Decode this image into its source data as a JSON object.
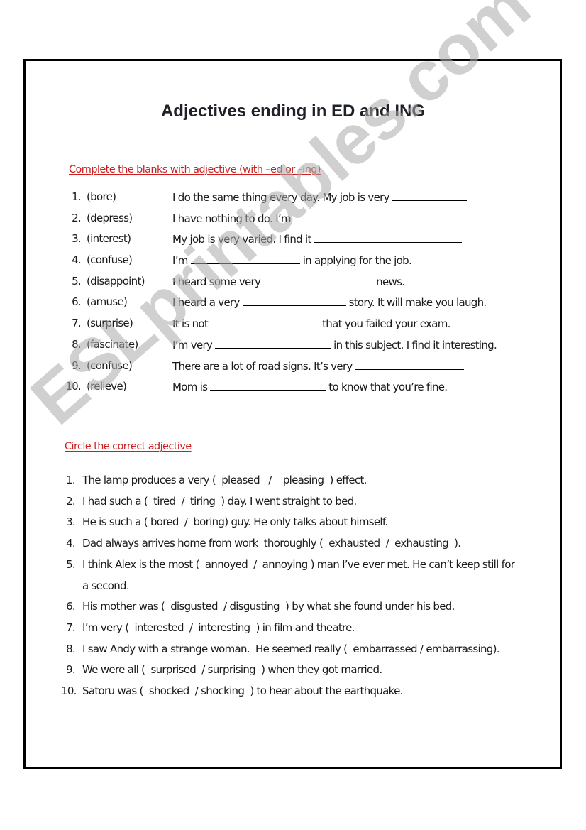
{
  "document": {
    "title": "Adjectives ending in ED and ING",
    "watermark": "ESLprintables.com",
    "colors": {
      "heading_red": "#cc1f1f",
      "text": "#1a1a1a",
      "border": "#000000",
      "watermark": "#c8c8c8"
    }
  },
  "exercise1": {
    "heading": "Complete the blanks with  adjective (with –ed or –ing)",
    "items": [
      {
        "num": "1.",
        "verb": "(bore)",
        "before": "I do the same thing every day. My job is very",
        "after": ""
      },
      {
        "num": "2.",
        "verb": "(depress)",
        "before": "I have nothing to do. I’m",
        "after": ""
      },
      {
        "num": "3.",
        "verb": "(interest)",
        "before": "My job is very varied. I find it",
        "after": ""
      },
      {
        "num": "4.",
        "verb": "(confuse)",
        "before": "I’m",
        "after": "in applying for the job."
      },
      {
        "num": "5.",
        "verb": "(disappoint)",
        "before": "I heard some very",
        "after": "news."
      },
      {
        "num": "6.",
        "verb": "(amuse)",
        "before": "I heard a very",
        "after": "story. It will make you laugh."
      },
      {
        "num": "7.",
        "verb": "(surprise)",
        "before": "It is not",
        "after": "that you failed your exam."
      },
      {
        "num": "8.",
        "verb": "(fascinate)",
        "before": "I’m very",
        "after": "in this subject. I find it interesting."
      },
      {
        "num": "9.",
        "verb": "(confuse)",
        "before": "There are a lot of road signs. It’s very",
        "after": ""
      },
      {
        "num": "10.",
        "verb": "(relieve)",
        "before": "Mom is",
        "after": "to know that you’re fine."
      }
    ]
  },
  "exercise2": {
    "heading": "Circle the correct adjective",
    "items": [
      {
        "num": "1.",
        "text": "The lamp produces a very (  pleased   /    pleasing  ) effect."
      },
      {
        "num": "2.",
        "text": "I had such a (  tired  /  tiring  ) day. I went straight to bed."
      },
      {
        "num": "3.",
        "text": "He is such a ( bored  /  boring) guy. He only talks about himself."
      },
      {
        "num": "4.",
        "text": "Dad always arrives home from work  thoroughly (  exhausted  /  exhausting  )."
      },
      {
        "num": "5.",
        "text": "I think Alex is the most (  annoyed  /  annoying ) man I’ve ever met. He can’t keep still for a second."
      },
      {
        "num": "6.",
        "text": "His mother was (  disgusted  / disgusting  ) by what she found under his bed."
      },
      {
        "num": "7.",
        "text": "I’m very (  interested  /  interesting  ) in film and theatre."
      },
      {
        "num": "8.",
        "text": "I saw Andy with a strange woman.  He seemed really (  embarrassed / embarrassing)."
      },
      {
        "num": "9.",
        "text": "We were all (  surprised  / surprising  ) when they got married."
      },
      {
        "num": "10.",
        "text": "Satoru was (  shocked  / shocking  ) to hear about the earthquake."
      }
    ]
  }
}
